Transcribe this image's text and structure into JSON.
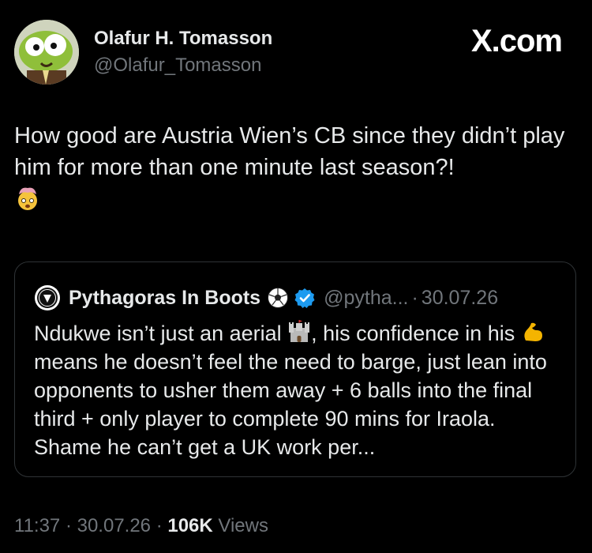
{
  "author": {
    "name": "Olafur H. Tomasson",
    "handle": "@Olafur_Tomasson"
  },
  "brand": {
    "label": "X.com"
  },
  "tweet": {
    "text": "How good are Austria Wien’s CB since they didn’t play him for more than one minute last season?!",
    "trailing_emoji": "exploding-head-icon"
  },
  "quoted_tweet": {
    "author_name": "Pythagoras In Boots",
    "handle": "@pytha...",
    "separator": "·",
    "date": "30.07.26",
    "text_part1": "Ndukwe isn’t just an aerial ",
    "text_part2": ", his confidence in his ",
    "text_part3": " means he doesn’t feel the need to barge, just lean into opponents to usher them away + 6 balls into the final third + only player to complete 90 mins for Iraola. Shame he can’t get a UK work per...",
    "emoji_1": "castle-icon",
    "emoji_2": "flexed-biceps-icon"
  },
  "footer": {
    "time": "11:37",
    "sep1": " · ",
    "date": "30.07.26",
    "sep2": " · ",
    "views_count": "106K",
    "views_label": " Views"
  },
  "colors": {
    "background": "#000000",
    "text_primary": "#e7e9ea",
    "text_secondary": "#71767b",
    "border": "#2f3336",
    "verified": "#1d9bf0"
  }
}
